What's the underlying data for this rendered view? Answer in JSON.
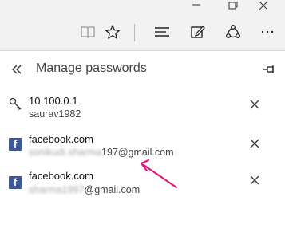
{
  "window": {
    "minimize_icon": "minimize-icon",
    "restore_icon": "restore-icon",
    "close_icon": "close-icon"
  },
  "toolbar": {
    "icons": [
      "reading-view-icon",
      "favorite-star-icon",
      "hub-icon",
      "web-note-icon",
      "share-icon",
      "more-icon"
    ],
    "more_label": "···"
  },
  "pane": {
    "title": "Manage passwords",
    "back_icon": "double-chevron-left-icon",
    "pin_icon": "pin-icon"
  },
  "passwords": [
    {
      "site": "10.100.0.1",
      "user": "saurav1982",
      "user_masked": "",
      "icon": "key-icon"
    },
    {
      "site": "facebook.com",
      "user_masked": "sonikudi.sharma",
      "user": "197@gmail.com",
      "icon": "facebook-icon"
    },
    {
      "site": "facebook.com",
      "user_masked": "sharma1997",
      "user": "@gmail.com",
      "icon": "facebook-icon"
    }
  ],
  "facebook_glyph": "f",
  "colors": {
    "annotation_arrow": "#e0187a",
    "facebook_blue": "#3b5998",
    "toolbar_bg": "#f2f2f2"
  }
}
